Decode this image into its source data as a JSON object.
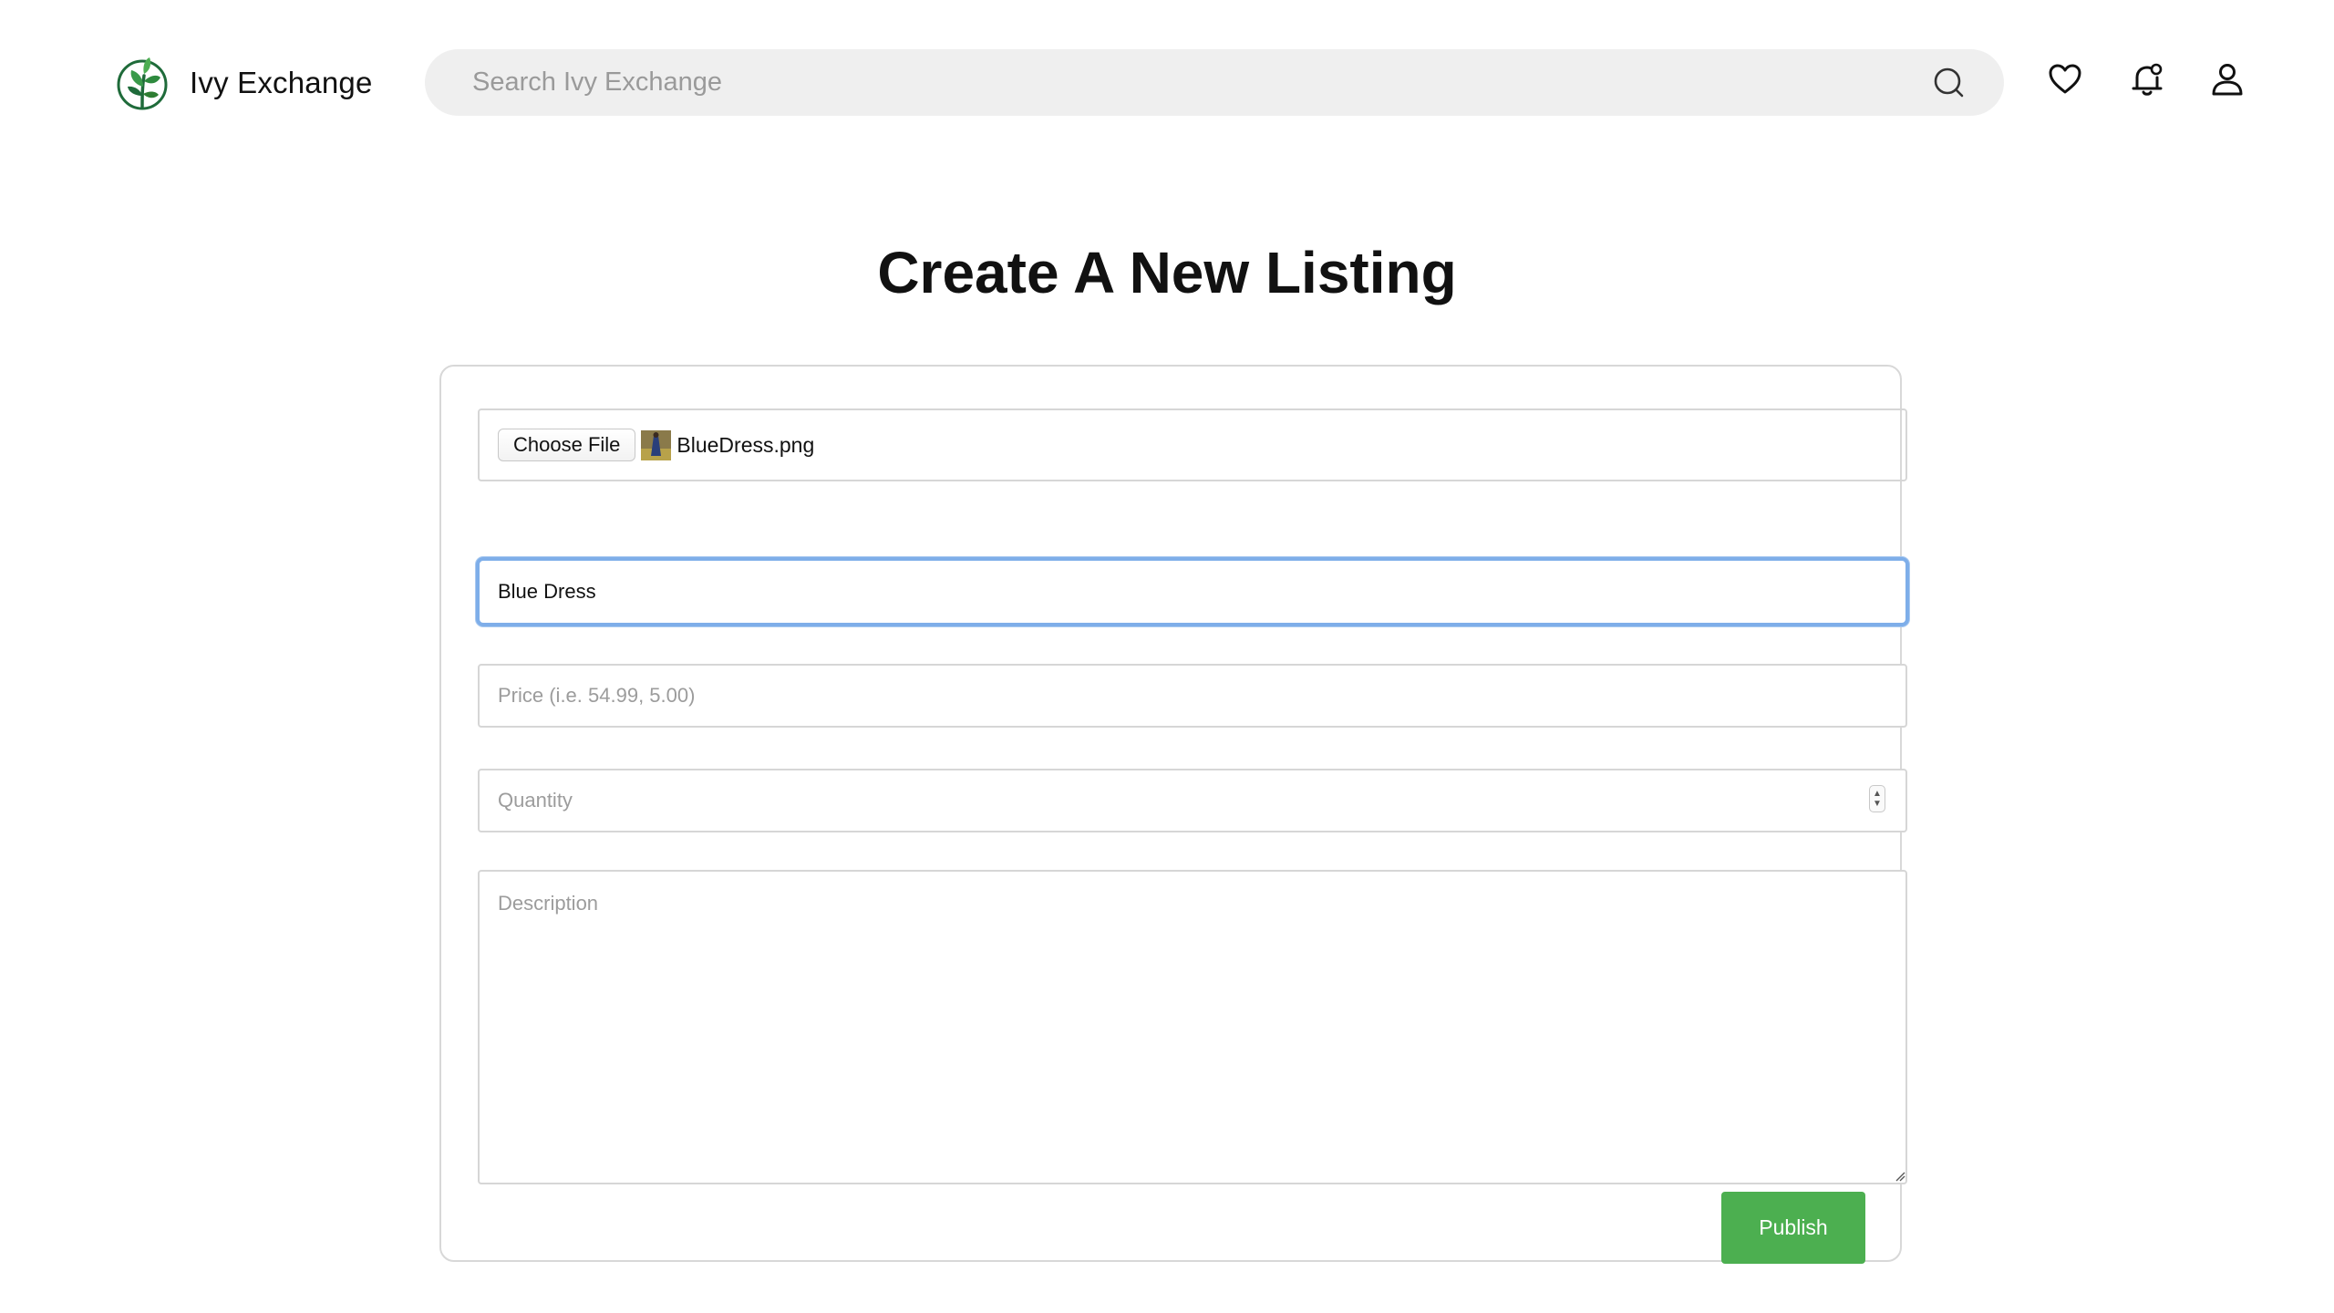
{
  "header": {
    "brand_name": "Ivy Exchange",
    "search_placeholder": "Search Ivy Exchange",
    "icons": [
      "leaf-logo-icon",
      "search-icon",
      "heart-icon",
      "bell-icon",
      "user-icon"
    ]
  },
  "page": {
    "title": "Create A New Listing"
  },
  "form": {
    "file": {
      "button_label": "Choose File",
      "file_name": "BlueDress.png"
    },
    "title": {
      "value": "Blue Dress"
    },
    "price": {
      "placeholder": "Price (i.e. 54.99, 5.00)"
    },
    "quantity": {
      "placeholder": "Quantity"
    },
    "description": {
      "placeholder": "Description"
    },
    "publish_label": "Publish"
  },
  "colors": {
    "brand_green": "#2e7d32",
    "publish_green": "#4caf50",
    "focus_blue": "#7eaee9",
    "search_bg": "#efefef"
  }
}
